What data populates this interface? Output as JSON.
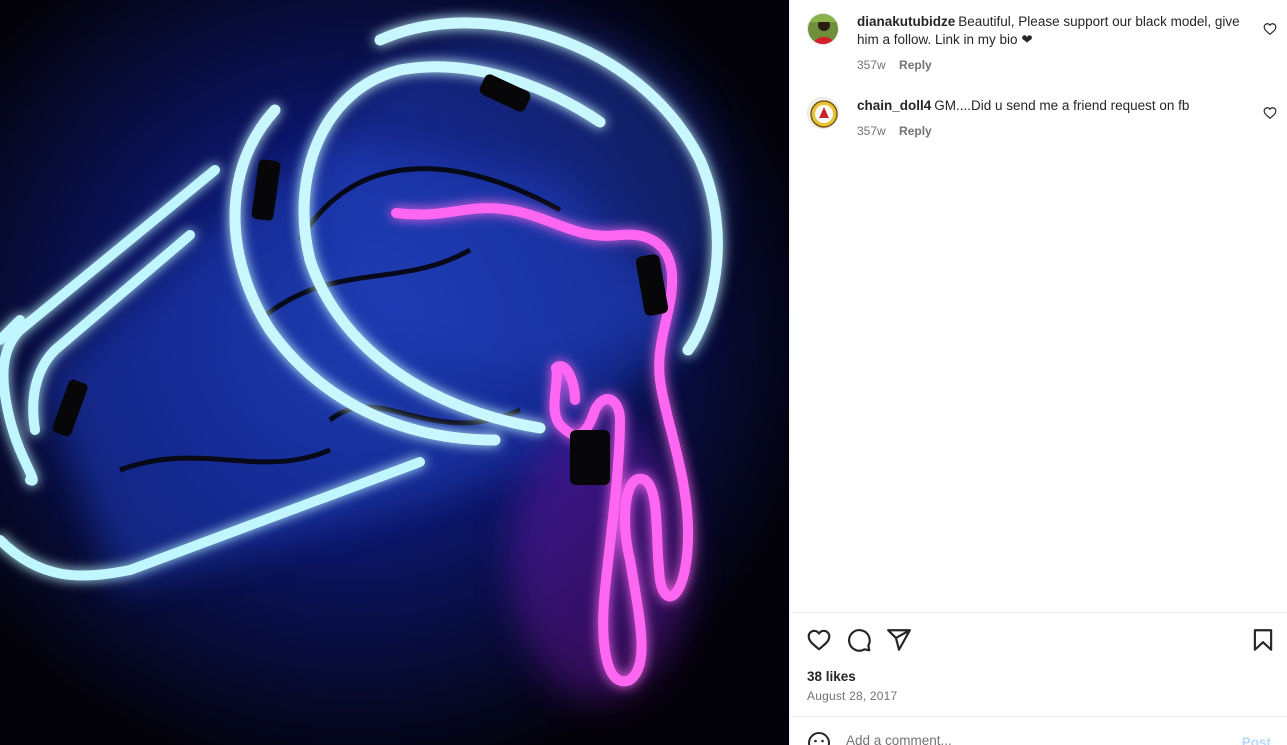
{
  "comments": [
    {
      "username": "dianakutubidze",
      "text": "Beautiful, Please support our black model, give him a follow. Link in my bio ❤︎",
      "time": "357w",
      "reply_label": "Reply"
    },
    {
      "username": "chain_doll4",
      "text": "GM....Did u send me a friend request on fb",
      "time": "357w",
      "reply_label": "Reply"
    }
  ],
  "likes_text": "38 likes",
  "date": "August 28, 2017",
  "add_comment": {
    "placeholder": "Add a comment...",
    "post_label": "Post"
  },
  "colors": {
    "neon_blue": "#bff6ff",
    "neon_pink": "#ff5cf0",
    "post_disabled": "#b3dbff",
    "text_secondary": "#737373"
  },
  "icons": [
    "heart-icon",
    "comment-icon",
    "share-icon",
    "save-icon",
    "emoji-icon"
  ]
}
